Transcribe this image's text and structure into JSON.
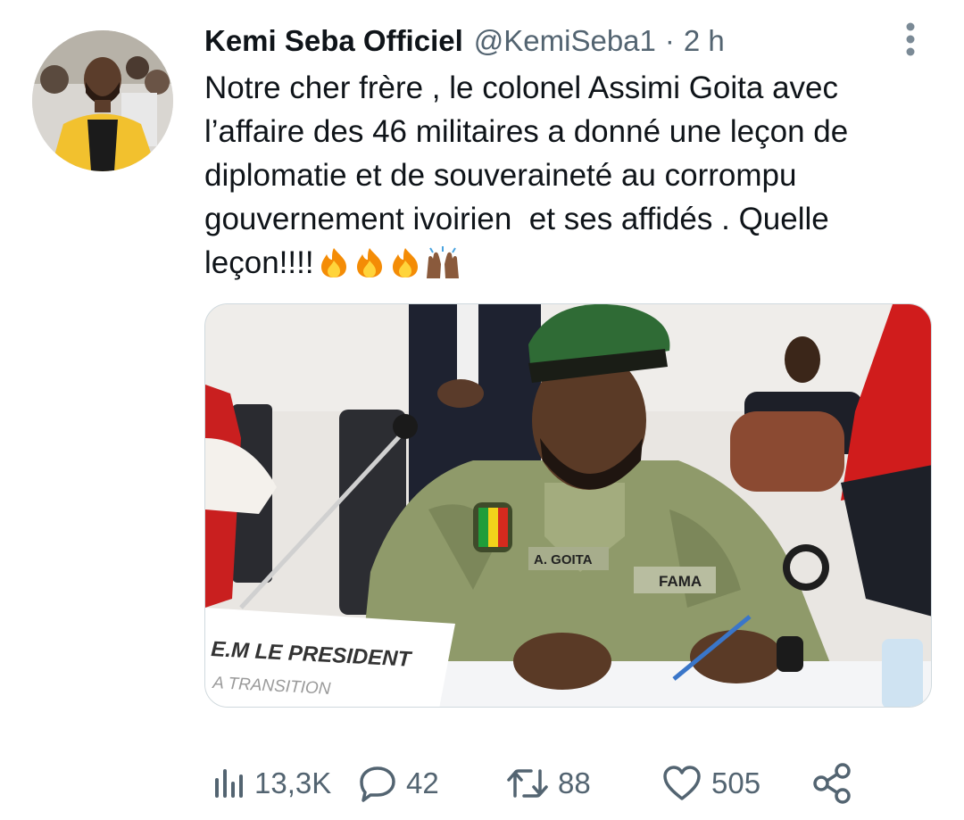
{
  "author": {
    "display_name": "Kemi Seba Officiel",
    "handle": "@KemiSeba1",
    "separator": "·",
    "time": "2 h",
    "avatar_icon": "profile-photo-yellow-jacket"
  },
  "tweet": {
    "text": "Notre cher frère , le colonel Assimi Goita avec l’affaire des 46 militaires a donné une leçon de diplomatie et de souveraineté au corrompu gouvernement ivoirien  et ses affidés . Quelle leçon!!!!",
    "emojis": [
      "fire-emoji",
      "fire-emoji",
      "fire-emoji",
      "raising-hands-emoji"
    ]
  },
  "media": {
    "placard_line1": "E.M LE PRESIDENT",
    "placard_line2": "A TRANSITION",
    "name_tag": "A. GOITA",
    "unit_tag": "FAMA",
    "colors": {
      "beret": "#2f6b35",
      "camo": "#8f9a6a",
      "flag_green": "#1f9d3a",
      "flag_yellow": "#f2d21b",
      "flag_red": "#d42a1e",
      "curtain_red": "#d01c1c"
    }
  },
  "actions": {
    "views": "13,3K",
    "replies": "42",
    "retweets": "88",
    "likes": "505"
  },
  "icons": {
    "views": "views-icon",
    "reply": "reply-icon",
    "retweet": "retweet-icon",
    "like": "heart-icon",
    "share": "share-icon",
    "more": "more-vertical-icon"
  }
}
